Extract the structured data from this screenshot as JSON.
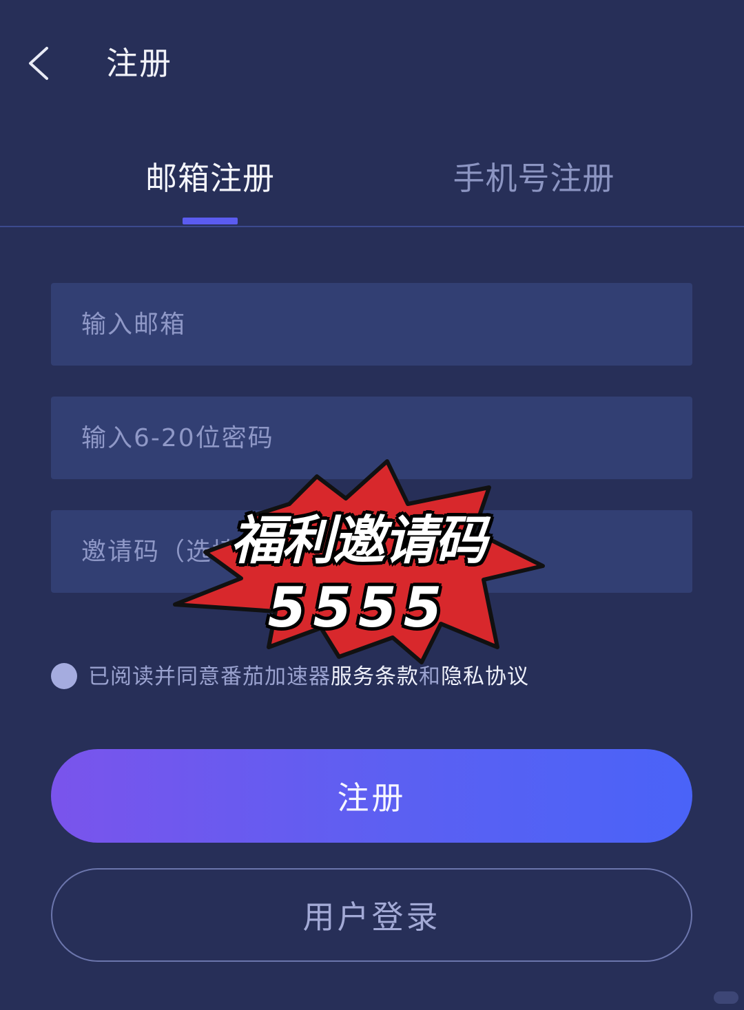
{
  "header": {
    "title": "注册",
    "back_icon": "chevron-left-icon"
  },
  "tabs": [
    {
      "label": "邮箱注册",
      "active": true
    },
    {
      "label": "手机号注册",
      "active": false
    }
  ],
  "form": {
    "email_placeholder": "输入邮箱",
    "password_placeholder": "输入6-20位密码",
    "invite_placeholder": "邀请码（选填）"
  },
  "agreement": {
    "prefix": "已阅读并同意番茄加速器",
    "terms_link": "服务条款",
    "conjunction": "和",
    "privacy_link": "隐私协议"
  },
  "buttons": {
    "register": "注册",
    "login": "用户登录"
  },
  "promo": {
    "title": "福利邀请码",
    "code": "5555"
  },
  "colors": {
    "background": "#272f58",
    "input_background": "#323f73",
    "accent": "#5b5cf0",
    "promo_red": "#d8282c"
  }
}
